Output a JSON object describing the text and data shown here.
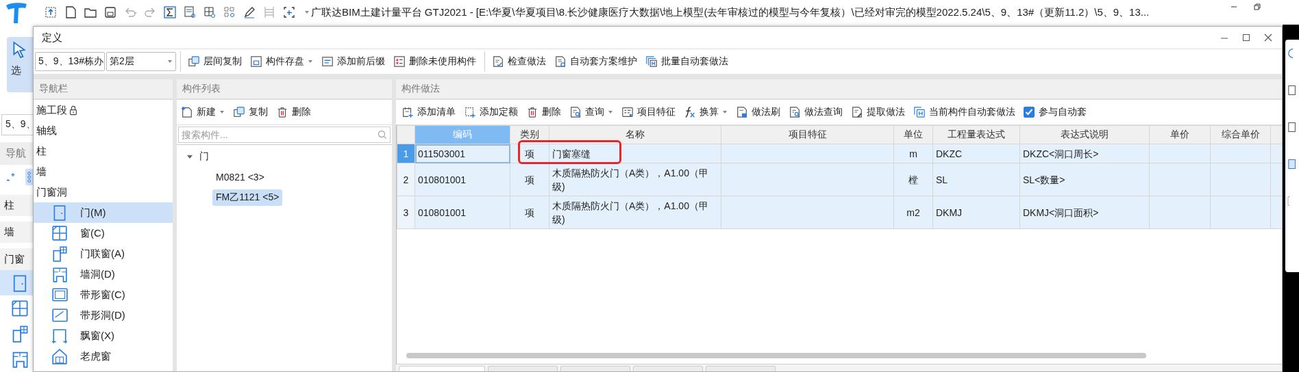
{
  "app": {
    "title": "广联达BIM土建计量平台 GTJ2021 - [E:\\华夏\\华夏项目\\8.长沙健康医疗大数据\\地上模型(去年审核过的模型与今年复核）\\已经对审完的模型2022.5.24\\5、9、13#（更新11.2）\\5、9、13...",
    "behind": {
      "tool_label": "选",
      "floor": "5、9、",
      "nav_title": "导航",
      "items": [
        {
          "label": "柱",
          "selected": false
        },
        {
          "label": "墙",
          "selected": false
        },
        {
          "label": "门窗",
          "selected": false
        }
      ],
      "icons": [
        {
          "selected": true
        },
        {
          "selected": false
        },
        {
          "selected": false
        },
        {
          "selected": false
        }
      ]
    }
  },
  "dialog": {
    "title": "定义",
    "building": "5、9、13#栋办",
    "floor": "第2层",
    "toolbar": [
      {
        "label": "层间复制",
        "dropdown": false,
        "separator_before": true
      },
      {
        "label": "构件存盘",
        "dropdown": true,
        "separator_before": false
      },
      {
        "label": "添加前后缀",
        "dropdown": false,
        "separator_before": false
      },
      {
        "label": "删除未使用构件",
        "dropdown": false,
        "separator_before": false
      },
      {
        "label": "检查做法",
        "dropdown": false,
        "separator_before": true
      },
      {
        "label": "自动套方案维护",
        "dropdown": false,
        "separator_before": false
      },
      {
        "label": "批量自动套做法",
        "dropdown": false,
        "separator_before": false
      }
    ]
  },
  "nav": {
    "title": "导航栏",
    "items": [
      {
        "label": "施工段",
        "locked": true,
        "selected": false
      },
      {
        "label": "轴线",
        "locked": false,
        "selected": false
      },
      {
        "label": "柱",
        "locked": false,
        "selected": false
      },
      {
        "label": "墙",
        "locked": false,
        "selected": false
      },
      {
        "label": "门窗洞",
        "locked": false,
        "selected": false,
        "children": [
          {
            "label": "门(M)",
            "selected": true
          },
          {
            "label": "窗(C)",
            "selected": false
          },
          {
            "label": "门联窗(A)",
            "selected": false
          },
          {
            "label": "墙洞(D)",
            "selected": false
          },
          {
            "label": "带形窗(C)",
            "selected": false
          },
          {
            "label": "带形洞(D)",
            "selected": false
          },
          {
            "label": "飘窗(X)",
            "selected": false
          },
          {
            "label": "老虎窗",
            "selected": false
          }
        ]
      }
    ]
  },
  "components": {
    "title": "构件列表",
    "toolbar": [
      {
        "label": "新建",
        "dropdown": true
      },
      {
        "label": "复制",
        "dropdown": false
      },
      {
        "label": "删除",
        "dropdown": false
      }
    ],
    "search": {
      "placeholder": "搜索构件..."
    },
    "tree": [
      {
        "label": "门",
        "expanded": true,
        "selected": false,
        "children": [
          {
            "label": "M0821 <3>",
            "selected": false
          },
          {
            "label": "FM乙1121 <5>",
            "selected": true
          }
        ]
      }
    ]
  },
  "methods": {
    "title": "构件做法",
    "toolbar": [
      {
        "label": "添加清单",
        "dropdown": false
      },
      {
        "label": "添加定额",
        "dropdown": false
      },
      {
        "label": "删除",
        "dropdown": false
      },
      {
        "label": "查询",
        "dropdown": true
      },
      {
        "label": "项目特征",
        "dropdown": false
      },
      {
        "label": "换算",
        "dropdown": true
      },
      {
        "label": "做法刷",
        "dropdown": false
      },
      {
        "label": "做法查询",
        "dropdown": false
      },
      {
        "label": "提取做法",
        "dropdown": false
      },
      {
        "label": "当前构件自动套做法",
        "dropdown": false
      }
    ],
    "auto_apply": {
      "label": "参与自动套",
      "checked": true
    },
    "table": {
      "columns": [
        {
          "label": "编码",
          "selected": true
        },
        {
          "label": "类别",
          "selected": false
        },
        {
          "label": "名称",
          "selected": false
        },
        {
          "label": "项目特征",
          "selected": false
        },
        {
          "label": "单位",
          "selected": false
        },
        {
          "label": "工程量表达式",
          "selected": false
        },
        {
          "label": "表达式说明",
          "selected": false
        },
        {
          "label": "单价",
          "selected": false
        },
        {
          "label": "综合单价",
          "selected": false
        }
      ],
      "rows": [
        {
          "number": "1",
          "selected": true,
          "code": "011503001",
          "category": "项",
          "name": "门窗塞缝",
          "unit": "m",
          "expression": "DKZC",
          "expression_note": "DKZC<洞口周长>"
        },
        {
          "number": "2",
          "selected": false,
          "code": "010801001",
          "category": "项",
          "name": "木质隔热防火门（A类），A1.00（甲级)",
          "unit": "樘",
          "expression": "SL",
          "expression_note": "SL<数量>"
        },
        {
          "number": "3",
          "selected": false,
          "code": "010801001",
          "category": "项",
          "name": "木质隔热防火门（A类），A1.00（甲级)",
          "unit": "m2",
          "expression": "DKMJ",
          "expression_note": "DKMJ<洞口面积>"
        }
      ]
    },
    "bottom_tabs": [
      {
        "selected": true
      },
      {
        "selected": false
      },
      {
        "selected": false
      },
      {
        "selected": false
      },
      {
        "selected": false
      }
    ]
  }
}
